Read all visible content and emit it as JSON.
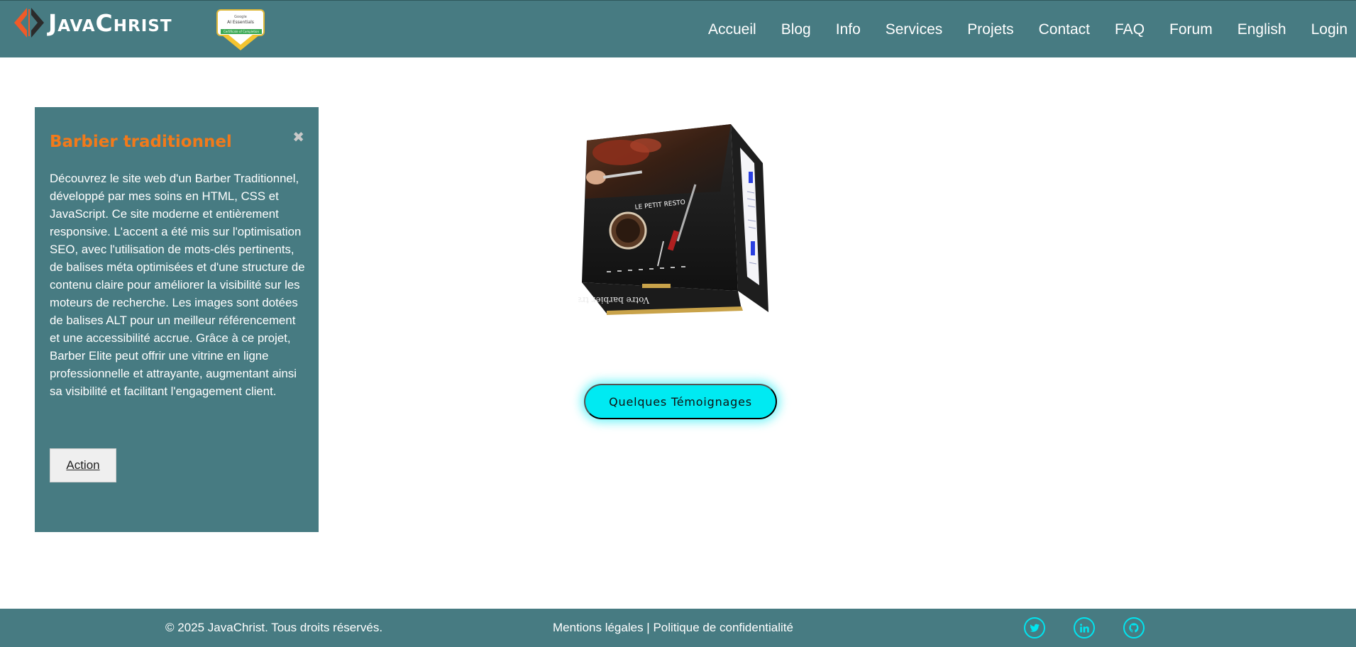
{
  "header": {
    "brand": "JavaChrist",
    "badge": {
      "line1": "Google",
      "line2": "AI Essentials",
      "line3": "Certificate of Completion"
    },
    "nav": [
      "Accueil",
      "Blog",
      "Info",
      "Services",
      "Projets",
      "Contact",
      "FAQ",
      "Forum",
      "English",
      "Login"
    ]
  },
  "card": {
    "title": "Barbier traditionnel",
    "close_icon": "close-icon",
    "description": "Découvrez le site web d'un Barber Traditionnel, développé par mes soins en HTML, CSS et JavaScript. Ce site moderne et entièrement responsive. L'accent a été mis sur l'optimisation SEO, avec l'utilisation de mots-clés pertinents, de balises méta optimisées et d'une structure de contenu claire pour améliorer la visibilité sur les moteurs de recherche. Les images sont dotées de balises ALT pour un meilleur référencement et une accessibilité accrue. Grâce à ce projet, Barber Elite peut offrir une vitrine en ligne professionnelle et attrayante, augmentant ainsi sa visibilité et facilitant l'engagement client.",
    "action_label": "Action"
  },
  "cube": {
    "front_text": "LE PETIT RESTO",
    "bottom_text": "Votre barbier traditionnel"
  },
  "testimonials_label": "Quelques Témoignages",
  "footer": {
    "copyright": "© 2025 JavaChrist. Tous droits réservés.",
    "legal": "Mentions légales",
    "separator": " | ",
    "privacy": "Politique de confidentialité",
    "socials": [
      "twitter-icon",
      "linkedin-icon",
      "github-icon"
    ]
  },
  "colors": {
    "header_bg": "#477b82",
    "accent_orange": "#f27a1a",
    "accent_cyan": "#00eaf2",
    "footer_icon": "#00e5f0"
  }
}
